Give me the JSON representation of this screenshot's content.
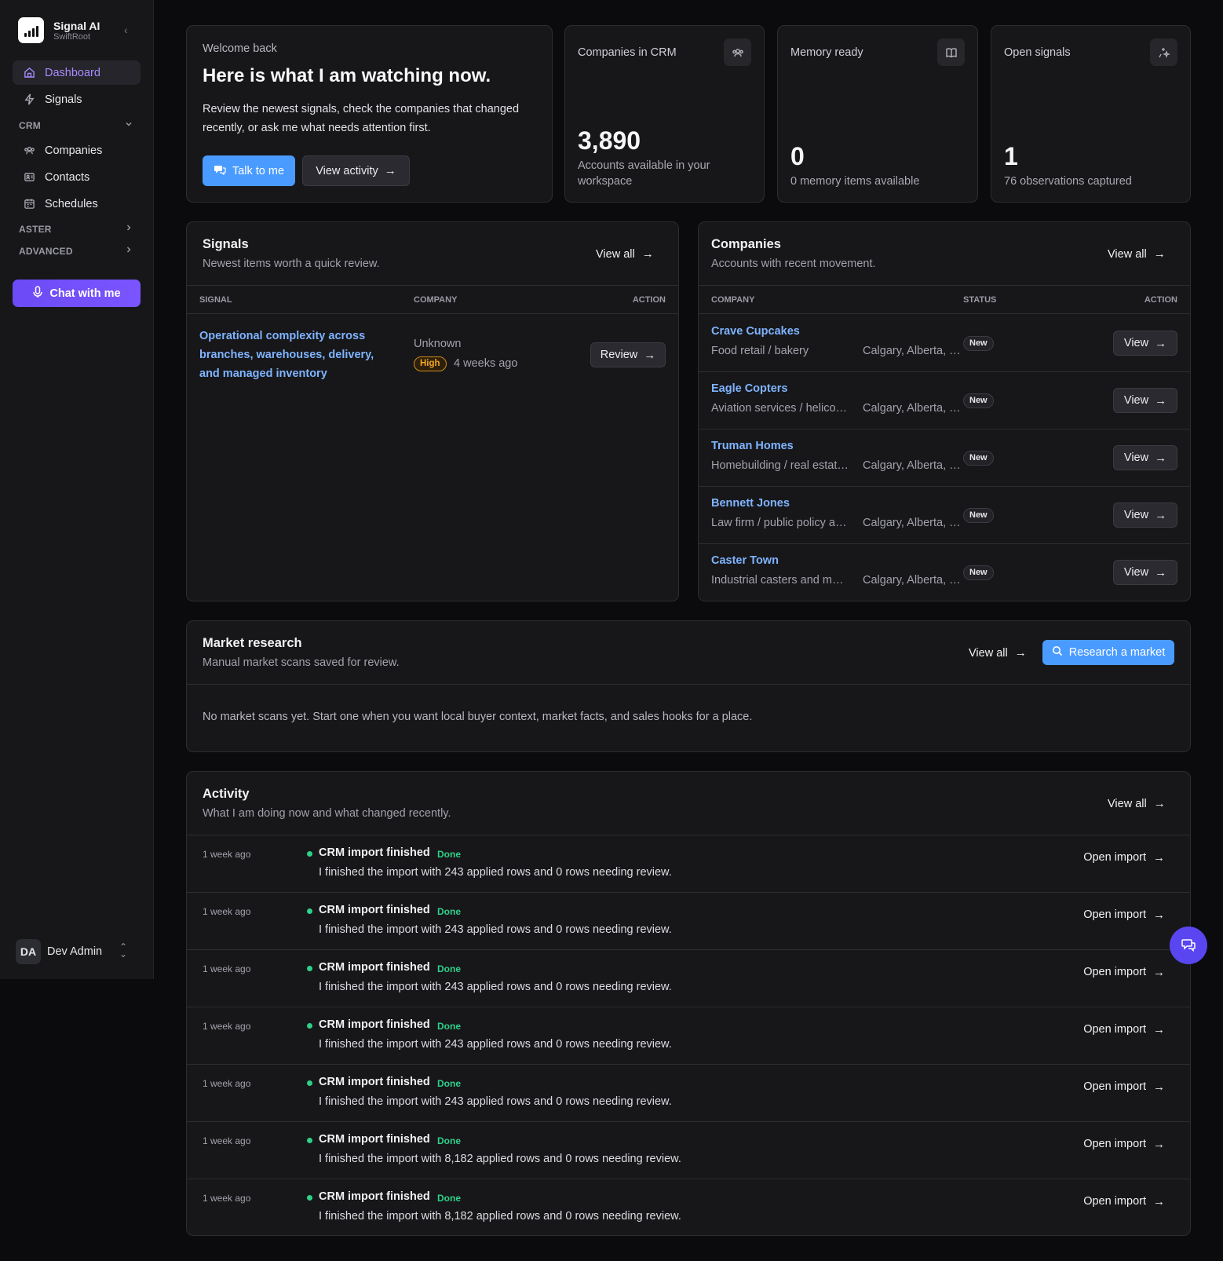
{
  "sidebar": {
    "brand_name": "Signal AI",
    "brand_sub": "SwiftRoot",
    "items": [
      {
        "label": "Dashboard",
        "icon": "home-icon"
      },
      {
        "label": "Signals",
        "icon": "lightning-icon"
      },
      {
        "label": "Companies",
        "icon": "companies-icon"
      },
      {
        "label": "Contacts",
        "icon": "contacts-icon"
      },
      {
        "label": "Schedules",
        "icon": "calendar-icon"
      }
    ],
    "sections": {
      "crm": "CRM",
      "aster": "ASTER",
      "advanced": "ADVANCED"
    },
    "chat_label": "Chat with me",
    "user_initials": "DA",
    "user_name": "Dev Admin",
    "accent": "#a98bff"
  },
  "welcome": {
    "eyebrow": "Welcome back",
    "title": "Here is what I am watching now.",
    "body": "Review the newest signals, check the companies that changed recently, or ask me what needs attention first.",
    "talk_label": "Talk to me",
    "activity_label": "View activity"
  },
  "stats": [
    {
      "title": "Companies in CRM",
      "value": "3,890",
      "desc": "Accounts available in your workspace",
      "icon": "companies-icon"
    },
    {
      "title": "Memory ready",
      "value": "0",
      "desc": "0 memory items available",
      "icon": "book-icon"
    },
    {
      "title": "Open signals",
      "value": "1",
      "desc": "76 observations captured",
      "icon": "sparkle-icon"
    }
  ],
  "signals": {
    "title": "Signals",
    "subtitle": "Newest items worth a quick review.",
    "view_all": "View all",
    "columns": {
      "signal": "SIGNAL",
      "company": "COMPANY",
      "action": "ACTION"
    },
    "rows": [
      {
        "signal": "Operational complexity across branches, warehouses, delivery, and managed inventory",
        "company": "Unknown",
        "priority": "High",
        "time": "4 weeks ago",
        "action": "Review"
      }
    ]
  },
  "companies": {
    "title": "Companies",
    "subtitle": "Accounts with recent movement.",
    "view_all": "View all",
    "columns": {
      "company": "COMPANY",
      "status": "STATUS",
      "action": "ACTION"
    },
    "rows": [
      {
        "name": "Crave Cupcakes",
        "industry": "Food retail / bakery",
        "location": "Calgary, Alberta, Canada",
        "status": "New",
        "action": "View"
      },
      {
        "name": "Eagle Copters",
        "industry": "Aviation services / helicopter operations",
        "location": "Calgary, Alberta, Canada",
        "status": "New",
        "action": "View"
      },
      {
        "name": "Truman Homes",
        "industry": "Homebuilding / real estate development",
        "location": "Calgary, Alberta, Canada",
        "status": "New",
        "action": "View"
      },
      {
        "name": "Bennett Jones",
        "industry": "Law firm / public policy advisory",
        "location": "Calgary, Alberta, Canada",
        "status": "New",
        "action": "View"
      },
      {
        "name": "Caster Town",
        "industry": "Industrial casters and materials handling",
        "location": "Calgary, Alberta, Canada",
        "status": "New",
        "action": "View"
      }
    ]
  },
  "market": {
    "title": "Market research",
    "subtitle": "Manual market scans saved for review.",
    "view_all": "View all",
    "research_label": "Research a market",
    "empty": "No market scans yet. Start one when you want local buyer context, market facts, and sales hooks for a place."
  },
  "activity": {
    "title": "Activity",
    "subtitle": "What I am doing now and what changed recently.",
    "view_all": "View all",
    "rows": [
      {
        "time": "1 week ago",
        "title": "CRM import finished",
        "status": "Done",
        "desc": "I finished the import with 243 applied rows and 0 rows needing review.",
        "action": "Open import"
      },
      {
        "time": "1 week ago",
        "title": "CRM import finished",
        "status": "Done",
        "desc": "I finished the import with 243 applied rows and 0 rows needing review.",
        "action": "Open import"
      },
      {
        "time": "1 week ago",
        "title": "CRM import finished",
        "status": "Done",
        "desc": "I finished the import with 243 applied rows and 0 rows needing review.",
        "action": "Open import"
      },
      {
        "time": "1 week ago",
        "title": "CRM import finished",
        "status": "Done",
        "desc": "I finished the import with 243 applied rows and 0 rows needing review.",
        "action": "Open import"
      },
      {
        "time": "1 week ago",
        "title": "CRM import finished",
        "status": "Done",
        "desc": "I finished the import with 243 applied rows and 0 rows needing review.",
        "action": "Open import"
      },
      {
        "time": "1 week ago",
        "title": "CRM import finished",
        "status": "Done",
        "desc": "I finished the import with 8,182 applied rows and 0 rows needing review.",
        "action": "Open import"
      },
      {
        "time": "1 week ago",
        "title": "CRM import finished",
        "status": "Done",
        "desc": "I finished the import with 8,182 applied rows and 0 rows needing review.",
        "action": "Open import"
      }
    ]
  }
}
